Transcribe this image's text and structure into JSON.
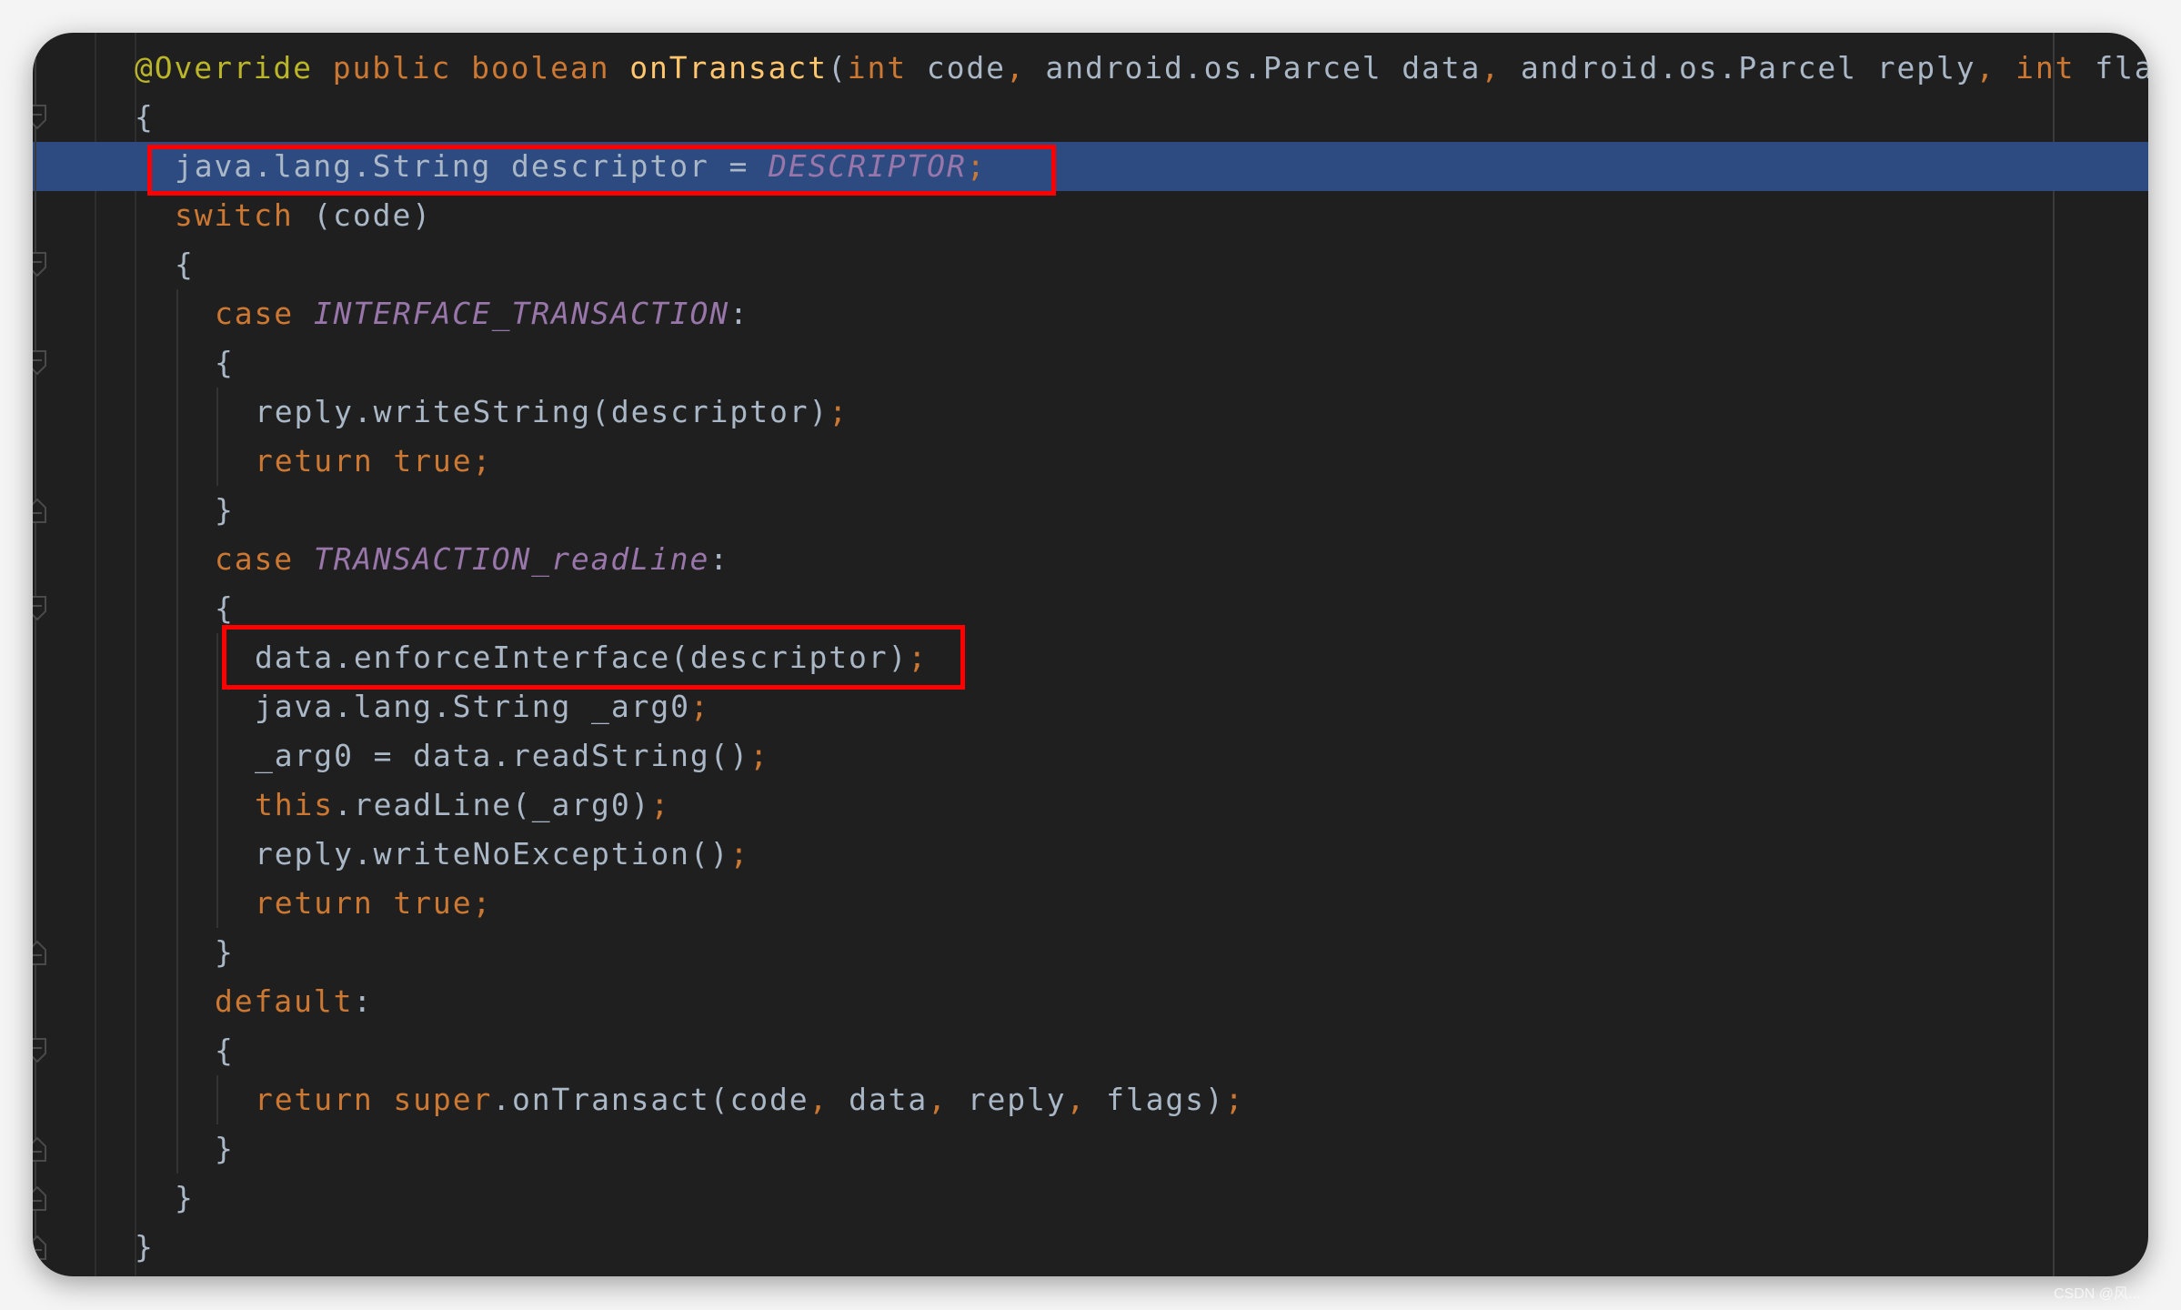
{
  "editor": {
    "theme_colors": {
      "background": "#1f1f1f",
      "highlight_line": "#2d4b80",
      "keyword": "#cc7832",
      "text": "#a9b7c6",
      "constant": "#9876aa",
      "annotation": "#bbb529",
      "method_declaration": "#ffc66d",
      "annotation_box": "#ff0000"
    },
    "highlighted_line_index": 2,
    "lines": [
      {
        "indent": 0,
        "tokens": [
          [
            "ann",
            "@Override"
          ],
          [
            "t",
            " "
          ],
          [
            "kw",
            "public"
          ],
          [
            "t",
            " "
          ],
          [
            "kw",
            "boolean"
          ],
          [
            "t",
            " "
          ],
          [
            "fn",
            "onTransact"
          ],
          [
            "t",
            "("
          ],
          [
            "kw",
            "int"
          ],
          [
            "t",
            " code"
          ],
          [
            "p",
            ","
          ],
          [
            "t",
            " android.os.Parcel data"
          ],
          [
            "p",
            ","
          ],
          [
            "t",
            " android.os.Parcel reply"
          ],
          [
            "p",
            ","
          ],
          [
            "t",
            " "
          ],
          [
            "kw",
            "int"
          ],
          [
            "t",
            " flags)"
          ]
        ]
      },
      {
        "indent": 0,
        "tokens": [
          [
            "t",
            "{"
          ]
        ]
      },
      {
        "indent": 1,
        "tokens": [
          [
            "t",
            "java.lang.String descriptor = "
          ],
          [
            "c",
            "DESCRIPTOR"
          ],
          [
            "p",
            ";"
          ]
        ]
      },
      {
        "indent": 1,
        "tokens": [
          [
            "kw",
            "switch"
          ],
          [
            "t",
            " (code)"
          ]
        ]
      },
      {
        "indent": 1,
        "tokens": [
          [
            "t",
            "{"
          ]
        ]
      },
      {
        "indent": 2,
        "tokens": [
          [
            "kw",
            "case"
          ],
          [
            "t",
            " "
          ],
          [
            "c",
            "INTERFACE_TRANSACTION"
          ],
          [
            "t",
            ":"
          ]
        ]
      },
      {
        "indent": 2,
        "tokens": [
          [
            "t",
            "{"
          ]
        ]
      },
      {
        "indent": 3,
        "tokens": [
          [
            "t",
            "reply.writeString(descriptor)"
          ],
          [
            "p",
            ";"
          ]
        ]
      },
      {
        "indent": 3,
        "tokens": [
          [
            "kw",
            "return"
          ],
          [
            "t",
            " "
          ],
          [
            "kw",
            "true"
          ],
          [
            "p",
            ";"
          ]
        ]
      },
      {
        "indent": 2,
        "tokens": [
          [
            "t",
            "}"
          ]
        ]
      },
      {
        "indent": 2,
        "tokens": [
          [
            "kw",
            "case"
          ],
          [
            "t",
            " "
          ],
          [
            "c",
            "TRANSACTION_readLine"
          ],
          [
            "t",
            ":"
          ]
        ]
      },
      {
        "indent": 2,
        "tokens": [
          [
            "t",
            "{"
          ]
        ]
      },
      {
        "indent": 3,
        "tokens": [
          [
            "t",
            "data.enforceInterface(descriptor)"
          ],
          [
            "p",
            ";"
          ]
        ]
      },
      {
        "indent": 3,
        "tokens": [
          [
            "t",
            "java.lang.String _arg0"
          ],
          [
            "p",
            ";"
          ]
        ]
      },
      {
        "indent": 3,
        "tokens": [
          [
            "t",
            "_arg0 = data.readString()"
          ],
          [
            "p",
            ";"
          ]
        ]
      },
      {
        "indent": 3,
        "tokens": [
          [
            "kw",
            "this"
          ],
          [
            "t",
            ".readLine(_arg0)"
          ],
          [
            "p",
            ";"
          ]
        ]
      },
      {
        "indent": 3,
        "tokens": [
          [
            "t",
            "reply.writeNoException()"
          ],
          [
            "p",
            ";"
          ]
        ]
      },
      {
        "indent": 3,
        "tokens": [
          [
            "kw",
            "return"
          ],
          [
            "t",
            " "
          ],
          [
            "kw",
            "true"
          ],
          [
            "p",
            ";"
          ]
        ]
      },
      {
        "indent": 2,
        "tokens": [
          [
            "t",
            "}"
          ]
        ]
      },
      {
        "indent": 2,
        "tokens": [
          [
            "kw",
            "default"
          ],
          [
            "t",
            ":"
          ]
        ]
      },
      {
        "indent": 2,
        "tokens": [
          [
            "t",
            "{"
          ]
        ]
      },
      {
        "indent": 3,
        "tokens": [
          [
            "kw",
            "return"
          ],
          [
            "t",
            " "
          ],
          [
            "kw",
            "super"
          ],
          [
            "t",
            ".onTransact(code"
          ],
          [
            "p",
            ","
          ],
          [
            "t",
            " data"
          ],
          [
            "p",
            ","
          ],
          [
            "t",
            " reply"
          ],
          [
            "p",
            ","
          ],
          [
            "t",
            " flags)"
          ],
          [
            "p",
            ";"
          ]
        ]
      },
      {
        "indent": 2,
        "tokens": [
          [
            "t",
            "}"
          ]
        ]
      },
      {
        "indent": 1,
        "tokens": [
          [
            "t",
            "}"
          ]
        ]
      },
      {
        "indent": 0,
        "tokens": [
          [
            "t",
            "}"
          ]
        ]
      }
    ],
    "annotations": [
      {
        "label": "descriptor-assignment-box",
        "line_index": 2
      },
      {
        "label": "enforce-interface-box",
        "line_index": 12
      }
    ]
  },
  "watermark": "CSDN @风..."
}
